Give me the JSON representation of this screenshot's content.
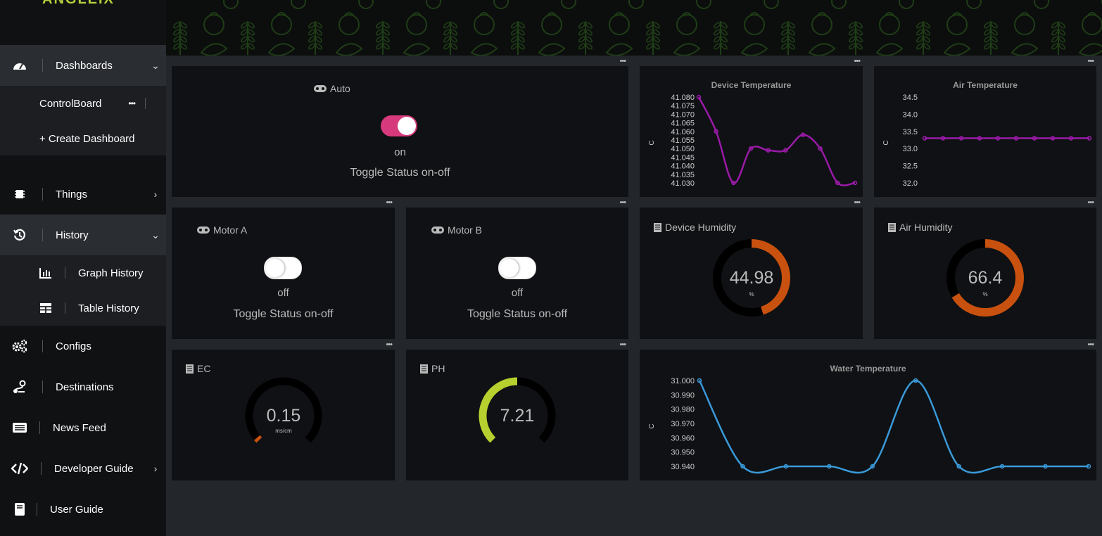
{
  "sidebar": {
    "brand": "ANGLEIX",
    "items": [
      {
        "label": "Dashboards",
        "chevron": "⌄"
      },
      {
        "label": "Things",
        "chevron": "›"
      },
      {
        "label": "History",
        "chevron": "⌄"
      },
      {
        "label": "Configs"
      },
      {
        "label": "Destinations"
      },
      {
        "label": "News Feed"
      },
      {
        "label": "Developer Guide",
        "chevron": "›"
      },
      {
        "label": "User Guide"
      }
    ],
    "dashboard_sub": {
      "controlboard": "ControlBoard",
      "create": "+ Create Dashboard",
      "more": "•••"
    },
    "history_sub": {
      "graph": "Graph History",
      "table": "Table History"
    }
  },
  "widgets": {
    "auto": {
      "title": "Auto",
      "state": "on",
      "desc": "Toggle Status on-off",
      "on": true
    },
    "motor_a": {
      "title": "Motor A",
      "state": "off",
      "desc": "Toggle Status on-off",
      "on": false
    },
    "motor_b": {
      "title": "Motor B",
      "state": "off",
      "desc": "Toggle Status on-off",
      "on": false
    },
    "device_humidity": {
      "title": "Device Humidity",
      "value": "44.98",
      "unit": "%",
      "fraction": 0.4498
    },
    "air_humidity": {
      "title": "Air Humidity",
      "value": "66.4",
      "unit": "%",
      "fraction": 0.664
    },
    "ec": {
      "title": "EC",
      "value": "0.15",
      "unit": "ms/cm",
      "fraction": 0.02
    },
    "ph": {
      "title": "PH",
      "value": "7.21",
      "unit": "",
      "fraction": 0.5
    },
    "more": "•••"
  },
  "colors": {
    "toggle_on": "#d63a7c",
    "humidity": "#c8510f",
    "ph": "#b7cf2f",
    "ec": "#c8510f",
    "device_temp": "#9a1aa8",
    "air_temp": "#9a1aa8",
    "water_temp": "#3a9ad9"
  },
  "chart_data": [
    {
      "type": "line",
      "title": "Device Temperature",
      "ylabel": "C",
      "ylim": [
        41.03,
        41.08
      ],
      "yticks": [
        "41.080",
        "41.075",
        "41.070",
        "41.065",
        "41.060",
        "41.055",
        "41.050",
        "41.045",
        "41.040",
        "41.035",
        "41.030"
      ],
      "series": [
        {
          "values": [
            41.08,
            41.06,
            41.03,
            41.05,
            41.049,
            41.049,
            41.058,
            41.05,
            41.03,
            41.03
          ]
        }
      ]
    },
    {
      "type": "line",
      "title": "Air Temperature",
      "ylabel": "C",
      "ylim": [
        32.0,
        34.5
      ],
      "yticks": [
        "34.5",
        "34.0",
        "33.5",
        "33.0",
        "32.5",
        "32.0"
      ],
      "series": [
        {
          "values": [
            33.3,
            33.3,
            33.3,
            33.3,
            33.3,
            33.3,
            33.3,
            33.3,
            33.3,
            33.3
          ]
        }
      ]
    },
    {
      "type": "line",
      "title": "Water Temperature",
      "ylabel": "C",
      "ylim": [
        30.94,
        31.0
      ],
      "yticks": [
        "31.000",
        "30.990",
        "30.980",
        "30.970",
        "30.960",
        "30.950",
        "30.940"
      ],
      "series": [
        {
          "values": [
            31.0,
            30.94,
            30.94,
            30.94,
            30.94,
            31.0,
            30.94,
            30.94,
            30.94,
            30.94
          ]
        }
      ]
    }
  ]
}
